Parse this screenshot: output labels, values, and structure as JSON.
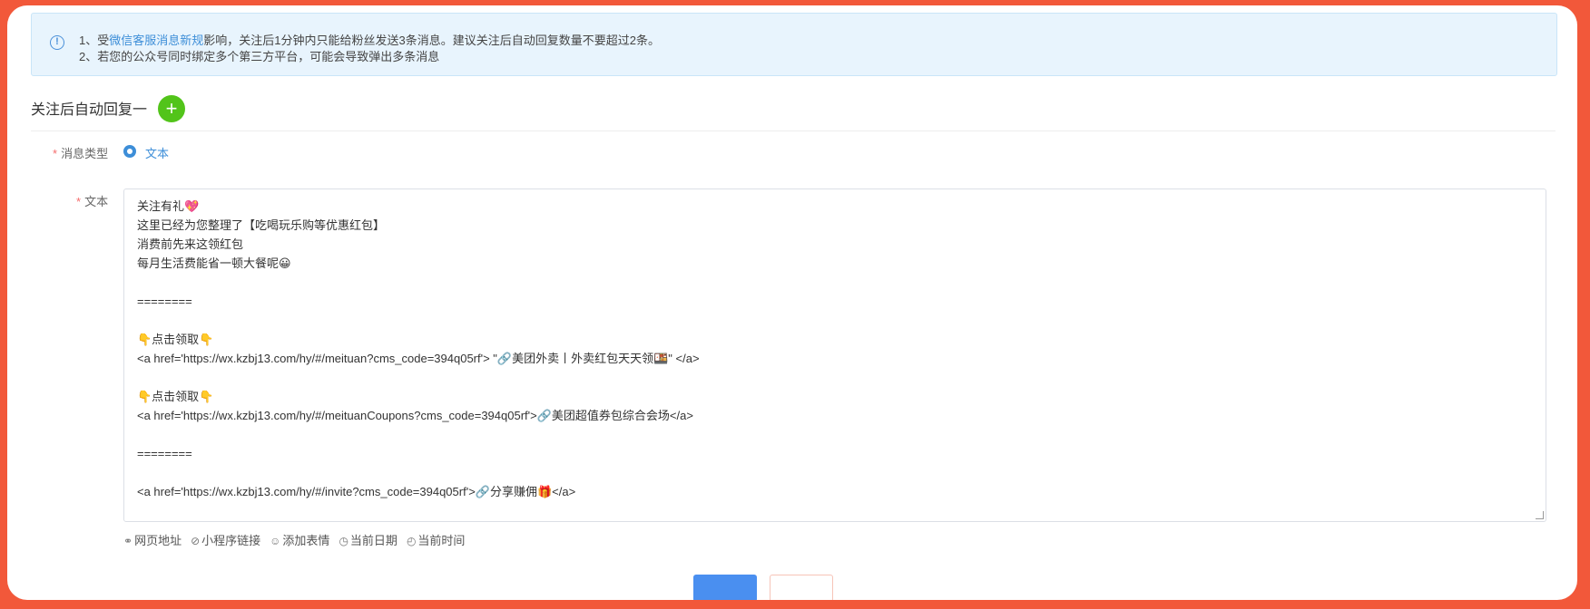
{
  "notice": {
    "icon": "info-circle-icon",
    "line1_prefix": "1、受",
    "line1_link": "微信客服消息新规",
    "line1_suffix": "影响，关注后1分钟内只能给粉丝发送3条消息。建议关注后自动回复数量不要超过2条。",
    "line2": "2、若您的公众号同时绑定多个第三方平台，可能会导致弹出多条消息"
  },
  "section": {
    "title": "关注后自动回复一",
    "add_icon": "plus-icon",
    "add_symbol": "+"
  },
  "form": {
    "required_mark": "*",
    "message_type_label": "消息类型",
    "message_type_option": "文本",
    "text_label": "文本",
    "text_lines": [
      "关注有礼💖",
      "这里已经为您整理了【吃喝玩乐购等优惠红包】",
      "消费前先来这领红包",
      "每月生活费能省一顿大餐呢😀",
      "",
      "========",
      "",
      "👇点击领取👇",
      "<a href='https://wx.kzbj13.com/hy/#/meituan?cms_code=394q05rf'> \"🔗美团外卖丨外卖红包天天领🍱\" </a>",
      "",
      "👇点击领取👇",
      "<a href='https://wx.kzbj13.com/hy/#/meituanCoupons?cms_code=394q05rf'>🔗美团超值券包综合会场</a>",
      "",
      "========",
      "",
      "<a href='https://wx.kzbj13.com/hy/#/invite?cms_code=394q05rf'>🔗分享赚佣🎁</a>"
    ]
  },
  "toolbar": [
    {
      "icon": "link-icon",
      "symbol": "⚭",
      "label": "网页地址"
    },
    {
      "icon": "mini-program-icon",
      "symbol": "⊘",
      "label": "小程序链接"
    },
    {
      "icon": "smiley-icon",
      "symbol": "☺",
      "label": "添加表情"
    },
    {
      "icon": "clock-icon",
      "symbol": "◷",
      "label": "当前日期"
    },
    {
      "icon": "timer-icon",
      "symbol": "◴",
      "label": "当前时间"
    }
  ],
  "colors": {
    "frame": "#f2583a",
    "accent": "#3d8ed8",
    "add_button": "#52c41a",
    "notice_bg": "#e8f4fd"
  }
}
